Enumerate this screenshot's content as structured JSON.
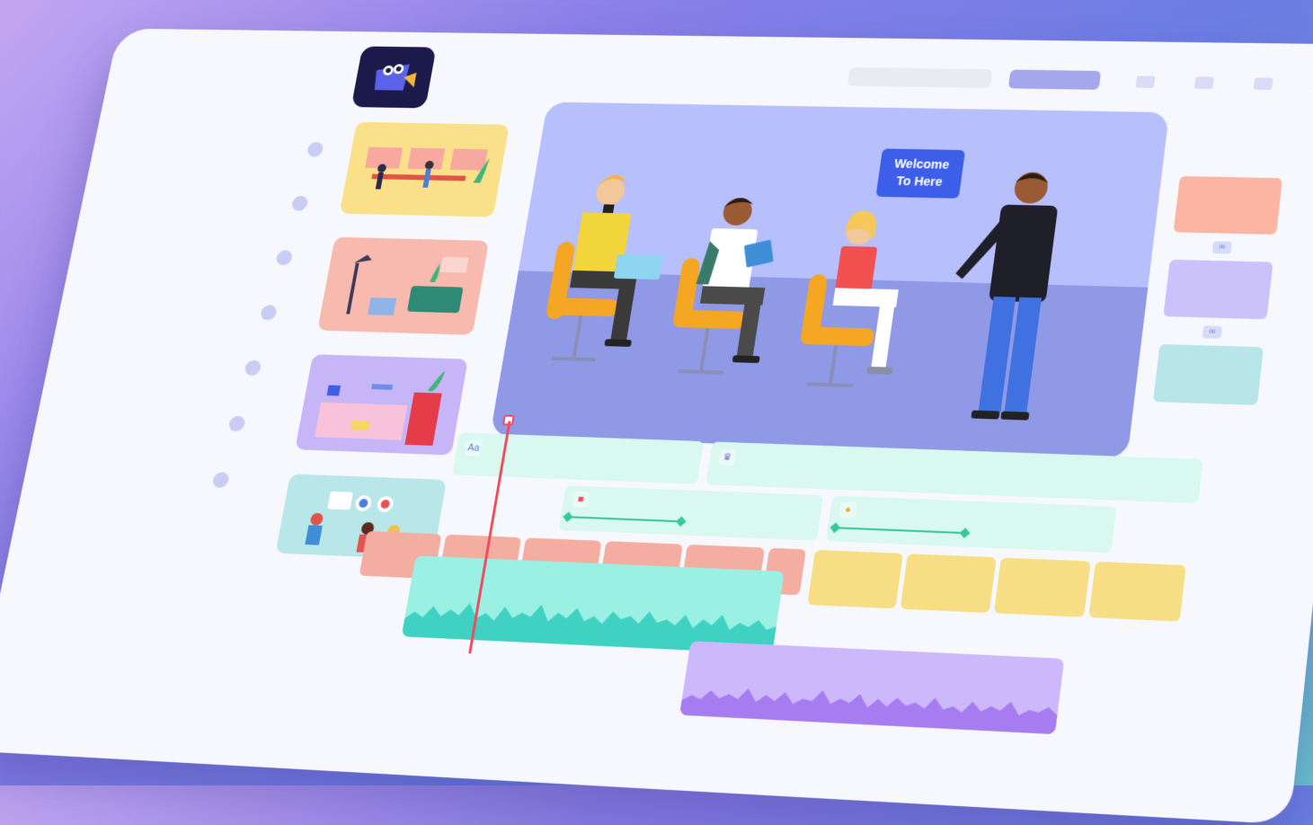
{
  "stage": {
    "bubble_line1": "Welcome",
    "bubble_line2": "To Here"
  },
  "timeline": {
    "text_track_icon": "Aa"
  },
  "icons": {
    "logo": "owl-logo-icon",
    "link": "link-icon",
    "text_layer": "text-icon",
    "crown": "crown-icon",
    "shape": "shape-icon",
    "character": "character-icon"
  },
  "colors": {
    "stage_bg": "#b7bffc",
    "stage_floor": "#8f99e6",
    "audio_teal": "#43d6c6",
    "audio_purple": "#b79cf3",
    "scene_red": "#f3aea1",
    "scene_yellow": "#f7de84",
    "track_mint": "#d9f8ef",
    "playhead": "#f04b5c",
    "card_salmon": "#fbb5a2",
    "card_lavender": "#cbc2fb",
    "card_teal": "#b8e5e8"
  }
}
